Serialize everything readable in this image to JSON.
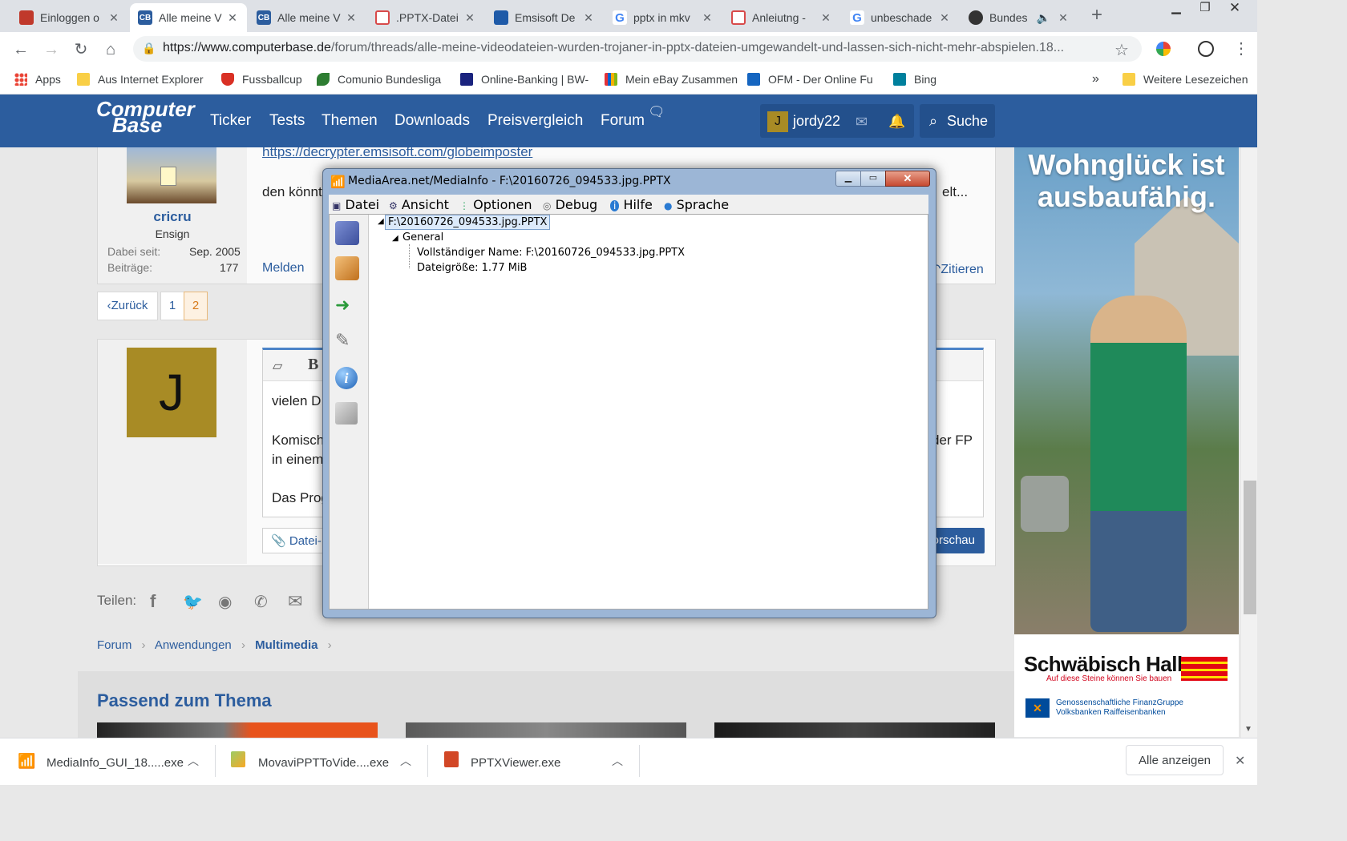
{
  "browser": {
    "tabs": [
      {
        "title": "Einloggen o",
        "active": false,
        "favicon_color": "#c0392b"
      },
      {
        "title": "Alle meine V",
        "active": true,
        "favicon_color": "#2c5d9e"
      },
      {
        "title": "Alle meine V",
        "active": false,
        "favicon_color": "#2c5d9e"
      },
      {
        "title": ".PPTX-Datei",
        "active": false,
        "favicon_color": "#d84a4a"
      },
      {
        "title": "Emsisoft De",
        "active": false,
        "favicon_color": "#1e5aa8"
      },
      {
        "title": "pptx in mkv",
        "active": false,
        "favicon_color": "#4285f4"
      },
      {
        "title": "Anleiutng -",
        "active": false,
        "favicon_color": "#d84a4a"
      },
      {
        "title": "unbeschade",
        "active": false,
        "favicon_color": "#4285f4"
      },
      {
        "title": "Bundes",
        "active": false,
        "favicon_color": "#333333"
      }
    ],
    "url_host": "https://www.computerbase.de",
    "url_path": "/forum/threads/alle-meine-videodateien-wurden-trojaner-in-pptx-dateien-umgewandelt-und-lassen-sich-nicht-mehr-abspielen.18...",
    "bookmarks": [
      {
        "label": "Apps",
        "color": "#ea4335"
      },
      {
        "label": "Aus Internet Explorer",
        "color": "#f9cf46"
      },
      {
        "label": "Fussballcup",
        "color": "#d93025"
      },
      {
        "label": "Comunio Bundesliga",
        "color": "#2e7d32"
      },
      {
        "label": "Online-Banking | BW-",
        "color": "#1a237e"
      },
      {
        "label": "Mein eBay Zusammen",
        "color": "#f5af02"
      },
      {
        "label": "OFM - Der Online Fu",
        "color": "#1565c0"
      },
      {
        "label": "Bing",
        "color": "#00809d"
      }
    ],
    "more_bookmarks": "»",
    "other_bookmarks": "Weitere Lesezeichen"
  },
  "site": {
    "logo_line1": "Computer",
    "logo_line2": "Base",
    "nav": [
      "Ticker",
      "Tests",
      "Themen",
      "Downloads",
      "Preisvergleich",
      "Forum"
    ],
    "user_initial": "J",
    "username": "jordy22",
    "search_label": "Suche"
  },
  "post": {
    "link": "https://decrypter.emsisoft.com/globeimposter",
    "text_fragment": "den könnt",
    "text_tail": "elt...",
    "author": "cricru",
    "rank": "Ensign",
    "joined_label": "Dabei seit:",
    "joined_value": "Sep. 2005",
    "posts_label": "Beiträge:",
    "posts_value": "177",
    "report": "Melden",
    "quote": "Zitieren"
  },
  "pagination": {
    "back": "Zurück",
    "pages": [
      "1",
      "2"
    ],
    "current": "2"
  },
  "reply": {
    "avatar_initial": "J",
    "bold_btn": "B",
    "line1": "vielen D",
    "line2a": "Komisch",
    "line2b": "der FP",
    "line3": "in einem",
    "line4": "Das Prog",
    "attach": "Datei-",
    "preview": "orschau"
  },
  "share_label": "Teilen:",
  "breadcrumb": [
    "Forum",
    "Anwendungen",
    "Multimedia"
  ],
  "related_heading": "Passend zum Thema",
  "ad": {
    "headline1": "Wohnglück ist",
    "headline2": "ausbaufähig.",
    "brand": "Schwäbisch Hall",
    "brand_tagline": "Auf diese Steine können Sie bauen",
    "group_line1": "Genossenschaftliche FinanzGruppe",
    "group_line2": "Volksbanken Raiffeisenbanken"
  },
  "mediainfo": {
    "title": "MediaArea.net/MediaInfo - F:\\20160726_094533.jpg.PPTX",
    "menu": [
      "Datei",
      "Ansicht",
      "Optionen",
      "Debug",
      "Hilfe",
      "Sprache"
    ],
    "tree_root": "F:\\20160726_094533.jpg.PPTX",
    "tree_section": "General",
    "tree_items": [
      "Vollständiger Name: F:\\20160726_094533.jpg.PPTX",
      "Dateigröße: 1.77 MiB"
    ]
  },
  "downloads": {
    "items": [
      "MediaInfo_GUI_18.....exe",
      "MovaviPPTToVide....exe",
      "PPTXViewer.exe"
    ],
    "show_all": "Alle anzeigen"
  }
}
